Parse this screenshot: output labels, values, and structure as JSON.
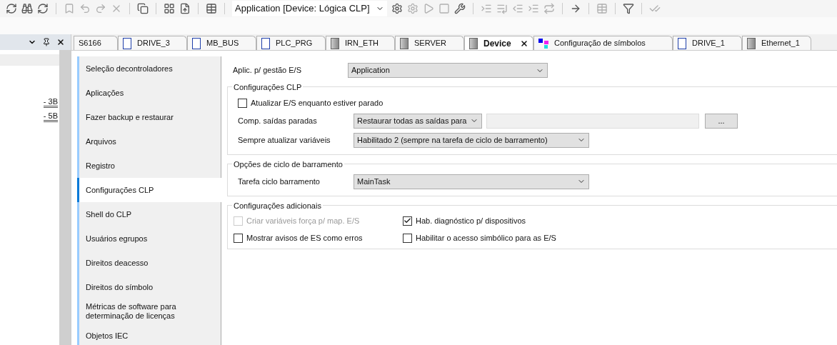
{
  "toolbar": {
    "application_selector": "Application [Device: Lógica CLP]"
  },
  "left_panel": {
    "items": [
      "- 3B",
      "- 5B"
    ]
  },
  "tabs": [
    {
      "label": "S6166",
      "kind": "plain",
      "selected": false
    },
    {
      "label": "DRIVE_3",
      "kind": "pou",
      "selected": false
    },
    {
      "label": "MB_BUS",
      "kind": "pou",
      "selected": false
    },
    {
      "label": "PLC_PRG",
      "kind": "pou",
      "selected": false
    },
    {
      "label": "IRN_ETH",
      "kind": "device",
      "selected": false
    },
    {
      "label": "SERVER",
      "kind": "device",
      "selected": false
    },
    {
      "label": "Device",
      "kind": "device",
      "selected": true
    },
    {
      "label": "Configuração de símbolos",
      "kind": "symbols",
      "selected": false
    },
    {
      "label": "DRIVE_1",
      "kind": "pou",
      "selected": false
    },
    {
      "label": "Ethernet_1",
      "kind": "device",
      "selected": false
    }
  ],
  "nav": [
    {
      "label": "Seleção decontroladores",
      "selected": false
    },
    {
      "label": "Aplicações",
      "selected": false
    },
    {
      "label": "Fazer backup e restaurar",
      "selected": false
    },
    {
      "label": "Arquivos",
      "selected": false
    },
    {
      "label": "Registro",
      "selected": false
    },
    {
      "label": "Configurações CLP",
      "selected": true
    },
    {
      "label": "Shell do CLP",
      "selected": false
    },
    {
      "label": "Usuários egrupos",
      "selected": false
    },
    {
      "label": "Direitos deacesso",
      "selected": false
    },
    {
      "label": "Direitos do símbolo",
      "selected": false
    },
    {
      "label": "Métricas de software para determinação de licenças",
      "selected": false
    },
    {
      "label": "Objetos IEC",
      "selected": false
    }
  ],
  "form": {
    "app_io": {
      "label": "Aplic. p/ gestão E/S",
      "value": "Application"
    },
    "groups": [
      {
        "title": "Configurações CLP",
        "rows": [
          {
            "kind": "checkbox",
            "label": "Atualizar E/S enquanto estiver parado",
            "checked": false,
            "disabled": false
          },
          {
            "kind": "select_field",
            "label": "Comp. saídas paradas",
            "value": "Restaurar todas as saídas para",
            "button": "..."
          },
          {
            "kind": "select",
            "label": "Sempre atualizar variáveis",
            "value": "Habilitado 2 (sempre na tarefa de ciclo de barramento)"
          }
        ]
      },
      {
        "title": "Opções de ciclo de barramento",
        "rows": [
          {
            "kind": "select",
            "label": "Tarefa ciclo barramento",
            "value": "MainTask"
          }
        ]
      }
    ],
    "additional": {
      "title": "Configurações adicionais",
      "options": [
        {
          "label": "Criar variáveis força p/ map. E/S",
          "checked": false,
          "disabled": true
        },
        {
          "label": "Hab. diagnóstico p/ dispositivos",
          "checked": true,
          "disabled": false
        },
        {
          "label": "Mostrar avisos de ES como erros",
          "checked": false,
          "disabled": false
        },
        {
          "label": "Habilitar o acesso simbólico para as E/S",
          "checked": false,
          "disabled": false
        }
      ]
    }
  }
}
